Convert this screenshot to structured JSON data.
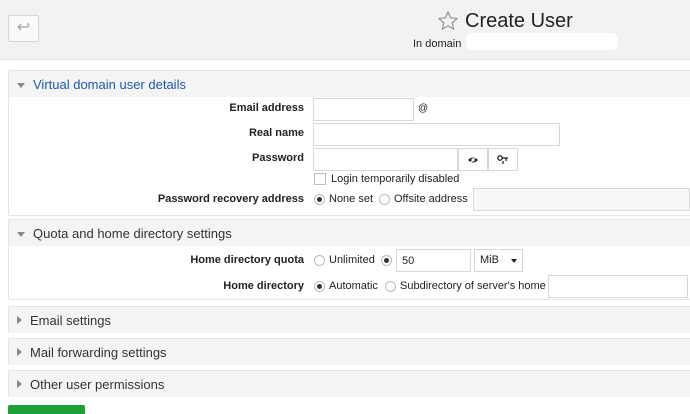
{
  "header": {
    "back_glyph": "↩",
    "title": "Create User",
    "subtitle": "In domain"
  },
  "sections": {
    "virtual": {
      "title": "Virtual domain user details",
      "email_label": "Email address",
      "email_value": "",
      "at_glyph": "@",
      "realname_label": "Real name",
      "realname_value": "",
      "password_label": "Password",
      "password_value": "",
      "login_disabled_label": "Login temporarily disabled",
      "recovery_label": "Password recovery address",
      "recovery_option_none": "None set",
      "recovery_option_offsite": "Offsite address",
      "recovery_value": ""
    },
    "quota": {
      "title": "Quota and home directory settings",
      "quota_label": "Home directory quota",
      "quota_option_unlimited": "Unlimited",
      "quota_value": "50",
      "quota_unit": "MiB",
      "homedir_label": "Home directory",
      "homedir_option_auto": "Automatic",
      "homedir_option_sub": "Subdirectory of server's home",
      "homedir_value": ""
    },
    "email_settings": {
      "title": "Email settings"
    },
    "mail_forwarding": {
      "title": "Mail forwarding settings"
    },
    "other_permissions": {
      "title": "Other user permissions"
    }
  },
  "icons": {
    "back": "back-arrow-icon",
    "star": "star-icon",
    "show_password": "eye-icon",
    "generate_password": "key-icon"
  },
  "colors": {
    "section_title_blue": "#1c5aa6",
    "create_button_green": "#1aa034",
    "header_bg": "#f2f2f2"
  }
}
